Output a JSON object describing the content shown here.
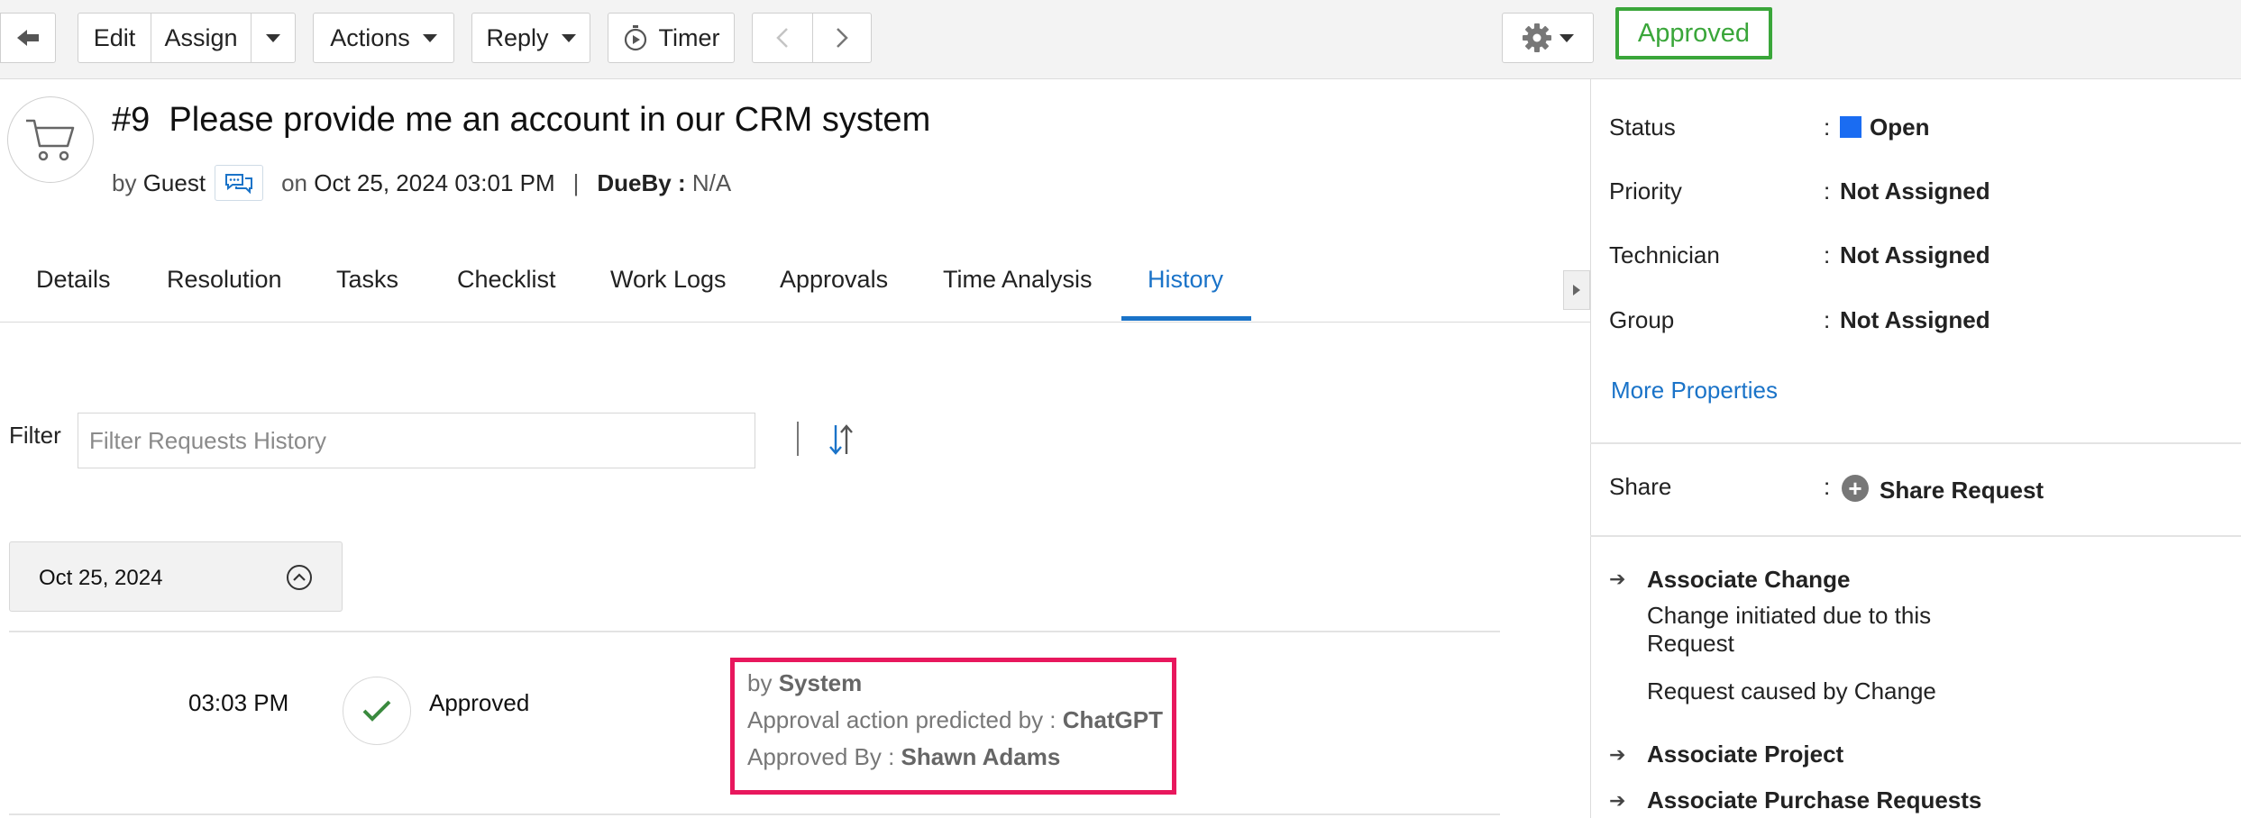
{
  "toolbar": {
    "edit_label": "Edit",
    "assign_label": "Assign",
    "actions_label": "Actions",
    "reply_label": "Reply",
    "timer_label": "Timer",
    "status_badge": "Approved",
    "icons": [
      "back-arrow-icon",
      "caret-down-icon",
      "timer-icon",
      "chevron-left-icon",
      "chevron-right-icon",
      "gear-icon"
    ]
  },
  "request": {
    "number": "#9",
    "title": "Please provide me an account in our CRM system",
    "by_label": "by",
    "requester": "Guest",
    "on_label": "on",
    "created": "Oct 25, 2024 03:01 PM",
    "separator": "|",
    "dueby_label": "DueBy :",
    "dueby_value": "N/A"
  },
  "tabs": [
    {
      "label": "Details"
    },
    {
      "label": "Resolution"
    },
    {
      "label": "Tasks"
    },
    {
      "label": "Checklist"
    },
    {
      "label": "Work Logs"
    },
    {
      "label": "Approvals"
    },
    {
      "label": "Time Analysis"
    },
    {
      "label": "History",
      "active": true
    }
  ],
  "filter": {
    "label": "Filter",
    "placeholder": "Filter Requests History"
  },
  "history": {
    "date": "Oct 25, 2024",
    "entries": [
      {
        "time": "03:03 PM",
        "action": "Approved",
        "by_label": "by",
        "by_value": "System",
        "predicted_label": "Approval action predicted by :",
        "predicted_value": "ChatGPT",
        "approved_label": "Approved By :",
        "approved_value": "Shawn Adams"
      }
    ]
  },
  "properties": {
    "colon": ":",
    "items": [
      {
        "label": "Status",
        "value": "Open"
      },
      {
        "label": "Priority",
        "value": "Not Assigned"
      },
      {
        "label": "Technician",
        "value": "Not Assigned"
      },
      {
        "label": "Group",
        "value": "Not Assigned"
      }
    ],
    "more_link": "More Properties",
    "share_label": "Share",
    "share_action": "Share Request"
  },
  "associations": {
    "change_title": "Associate Change",
    "change_option_1": "Change initiated due to this Request",
    "change_option_2": "Request caused by Change",
    "project_title": "Associate Project",
    "purchase_title": "Associate Purchase Requests"
  },
  "colors": {
    "accent": "#1a73c8",
    "approved_green": "#3aa63a",
    "highlight_box": "#e8175d",
    "status_open": "#1a6cf2"
  }
}
